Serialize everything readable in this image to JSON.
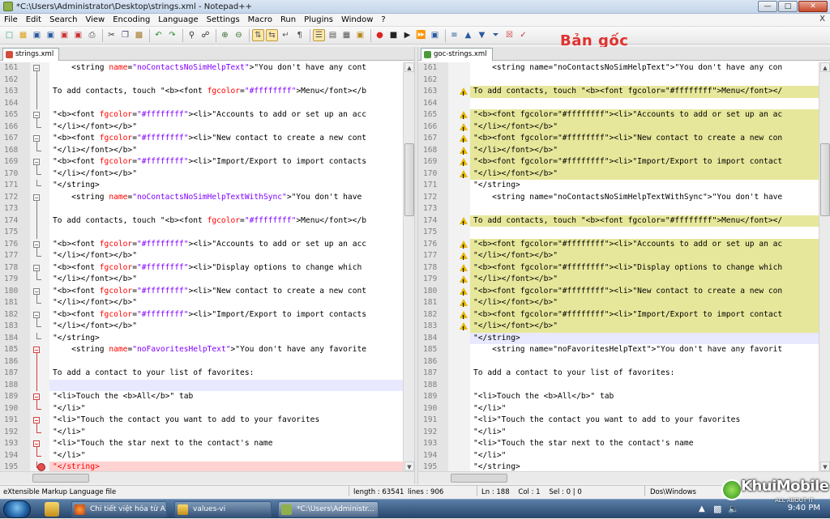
{
  "window": {
    "title": "*C:\\Users\\Administrator\\Desktop\\strings.xml - Notepad++"
  },
  "menu": [
    "File",
    "Edit",
    "Search",
    "View",
    "Encoding",
    "Language",
    "Settings",
    "Macro",
    "Run",
    "Plugins",
    "Window",
    "?"
  ],
  "menu_close": "X",
  "overlay_label": "Bản gốc",
  "left_tab": "strings.xml",
  "right_tab": "goc-strings.xml",
  "left_lines": [
    {
      "n": "161",
      "fold": "box",
      "segs": [
        [
          "t",
          "    <"
        ],
        [
          "t",
          "string "
        ],
        [
          "a",
          "name"
        ],
        [
          "t",
          "="
        ],
        [
          "s",
          "\"noContactsNoSimHelpText\""
        ],
        [
          "t",
          ">\"You don't have any cont"
        ]
      ]
    },
    {
      "n": "162",
      "fold": "line",
      "segs": []
    },
    {
      "n": "163",
      "fold": "line",
      "segs": [
        [
          "t",
          "To add contacts, touch \"<b><font "
        ],
        [
          "a",
          "fgcolor"
        ],
        [
          "t",
          "="
        ],
        [
          "s",
          "\"#ffffffff\""
        ],
        [
          "t",
          ">Menu</font></b"
        ]
      ]
    },
    {
      "n": "164",
      "fold": "line",
      "segs": []
    },
    {
      "n": "165",
      "fold": "box",
      "segs": [
        [
          "t",
          "\"<b><font "
        ],
        [
          "a",
          "fgcolor"
        ],
        [
          "t",
          "="
        ],
        [
          "s",
          "\"#ffffffff\""
        ],
        [
          "t",
          "><li>\"Accounts to add or set up an acc"
        ]
      ]
    },
    {
      "n": "166",
      "fold": "end",
      "segs": [
        [
          "t",
          "\"</li></font></b>\""
        ]
      ]
    },
    {
      "n": "167",
      "fold": "box",
      "segs": [
        [
          "t",
          "\"<b><font "
        ],
        [
          "a",
          "fgcolor"
        ],
        [
          "t",
          "="
        ],
        [
          "s",
          "\"#ffffffff\""
        ],
        [
          "t",
          "><li>\"New contact to create a new cont"
        ]
      ]
    },
    {
      "n": "168",
      "fold": "end",
      "segs": [
        [
          "t",
          "\"</li></font></b>\""
        ]
      ]
    },
    {
      "n": "169",
      "fold": "box",
      "segs": [
        [
          "t",
          "\"<b><font "
        ],
        [
          "a",
          "fgcolor"
        ],
        [
          "t",
          "="
        ],
        [
          "s",
          "\"#ffffffff\""
        ],
        [
          "t",
          "><li>\"Import/Export to import contacts"
        ]
      ]
    },
    {
      "n": "170",
      "fold": "end",
      "segs": [
        [
          "t",
          "\"</li></font></b>\""
        ]
      ]
    },
    {
      "n": "171",
      "fold": "end",
      "segs": [
        [
          "t",
          "\"</string>"
        ]
      ]
    },
    {
      "n": "172",
      "fold": "box",
      "segs": [
        [
          "t",
          "    <"
        ],
        [
          "t",
          "string "
        ],
        [
          "a",
          "name"
        ],
        [
          "t",
          "="
        ],
        [
          "s",
          "\"noContactsNoSimHelpTextWithSync\""
        ],
        [
          "t",
          ">\"You don't have "
        ]
      ]
    },
    {
      "n": "173",
      "fold": "line",
      "segs": []
    },
    {
      "n": "174",
      "fold": "line",
      "segs": [
        [
          "t",
          "To add contacts, touch \"<b><font "
        ],
        [
          "a",
          "fgcolor"
        ],
        [
          "t",
          "="
        ],
        [
          "s",
          "\"#ffffffff\""
        ],
        [
          "t",
          ">Menu</font></b"
        ]
      ]
    },
    {
      "n": "175",
      "fold": "line",
      "segs": []
    },
    {
      "n": "176",
      "fold": "box",
      "segs": [
        [
          "t",
          "\"<b><font "
        ],
        [
          "a",
          "fgcolor"
        ],
        [
          "t",
          "="
        ],
        [
          "s",
          "\"#ffffffff\""
        ],
        [
          "t",
          "><li>\"Accounts to add or set up an acc"
        ]
      ]
    },
    {
      "n": "177",
      "fold": "end",
      "segs": [
        [
          "t",
          "\"</li></font></b>\""
        ]
      ]
    },
    {
      "n": "178",
      "fold": "box",
      "segs": [
        [
          "t",
          "\"<b><font "
        ],
        [
          "a",
          "fgcolor"
        ],
        [
          "t",
          "="
        ],
        [
          "s",
          "\"#ffffffff\""
        ],
        [
          "t",
          "><li>\"Display options to change which "
        ]
      ]
    },
    {
      "n": "179",
      "fold": "end",
      "segs": [
        [
          "t",
          "\"</li></font></b>\""
        ]
      ]
    },
    {
      "n": "180",
      "fold": "box",
      "segs": [
        [
          "t",
          "\"<b><font "
        ],
        [
          "a",
          "fgcolor"
        ],
        [
          "t",
          "="
        ],
        [
          "s",
          "\"#ffffffff\""
        ],
        [
          "t",
          "><li>\"New contact to create a new cont"
        ]
      ]
    },
    {
      "n": "181",
      "fold": "end",
      "segs": [
        [
          "t",
          "\"</li></font></b>\""
        ]
      ]
    },
    {
      "n": "182",
      "fold": "box",
      "segs": [
        [
          "t",
          "\"<b><font "
        ],
        [
          "a",
          "fgcolor"
        ],
        [
          "t",
          "="
        ],
        [
          "s",
          "\"#ffffffff\""
        ],
        [
          "t",
          "><li>\"Import/Export to import contacts"
        ]
      ]
    },
    {
      "n": "183",
      "fold": "end",
      "segs": [
        [
          "t",
          "\"</li></font></b>\""
        ]
      ]
    },
    {
      "n": "184",
      "fold": "end",
      "segs": [
        [
          "t",
          "\"</string>"
        ]
      ]
    },
    {
      "n": "185",
      "fold": "boxred",
      "segs": [
        [
          "t",
          "    <"
        ],
        [
          "t",
          "string "
        ],
        [
          "a",
          "name"
        ],
        [
          "t",
          "="
        ],
        [
          "s",
          "\"noFavoritesHelpText\""
        ],
        [
          "t",
          ">\"You don't have any favorite"
        ]
      ]
    },
    {
      "n": "186",
      "fold": "linered",
      "segs": []
    },
    {
      "n": "187",
      "fold": "linered",
      "segs": [
        [
          "t",
          "To add a contact to your list of favorites:"
        ]
      ]
    },
    {
      "n": "188",
      "fold": "linered",
      "cls": "cur",
      "segs": []
    },
    {
      "n": "189",
      "fold": "boxred",
      "segs": [
        [
          "t",
          "\"<li>Touch the <b>All</b>\" tab"
        ]
      ]
    },
    {
      "n": "190",
      "fold": "endred",
      "segs": [
        [
          "t",
          "\"</li>\""
        ]
      ]
    },
    {
      "n": "191",
      "fold": "boxred",
      "segs": [
        [
          "t",
          "\"<li>\"Touch the contact you want to add to your favorites"
        ]
      ]
    },
    {
      "n": "192",
      "fold": "endred",
      "segs": [
        [
          "t",
          "\"</li>\""
        ]
      ]
    },
    {
      "n": "193",
      "fold": "boxred",
      "segs": [
        [
          "t",
          "\"<li>\"Touch the star next to the contact's name"
        ]
      ]
    },
    {
      "n": "194",
      "fold": "endred",
      "segs": [
        [
          "t",
          "\"</li>\""
        ]
      ]
    },
    {
      "n": "195",
      "fold": "errend",
      "cls": "err",
      "segs": [
        [
          "a",
          "\"</string>"
        ]
      ]
    }
  ],
  "right_lines": [
    {
      "n": "161",
      "w": 0,
      "t": "    <string name=\"noContactsNoSimHelpText\">\"You don't have any con"
    },
    {
      "n": "162",
      "w": 0,
      "t": ""
    },
    {
      "n": "163",
      "w": 1,
      "t": "To add contacts, touch \"<b><font fgcolor=\"#ffffffff\">Menu</font></"
    },
    {
      "n": "164",
      "w": 0,
      "t": ""
    },
    {
      "n": "165",
      "w": 1,
      "t": "\"<b><font fgcolor=\"#ffffffff\"><li>\"Accounts to add or set up an ac"
    },
    {
      "n": "166",
      "w": 1,
      "t": "\"</li></font></b>\""
    },
    {
      "n": "167",
      "w": 1,
      "t": "\"<b><font fgcolor=\"#ffffffff\"><li>\"New contact to create a new con"
    },
    {
      "n": "168",
      "w": 1,
      "t": "\"</li></font></b>\""
    },
    {
      "n": "169",
      "w": 1,
      "t": "\"<b><font fgcolor=\"#ffffffff\"><li>\"Import/Export to import contact"
    },
    {
      "n": "170",
      "w": 1,
      "t": "\"</li></font></b>\""
    },
    {
      "n": "171",
      "w": 0,
      "t": "\"</string>"
    },
    {
      "n": "172",
      "w": 0,
      "t": "    <string name=\"noContactsNoSimHelpTextWithSync\">\"You don't have"
    },
    {
      "n": "173",
      "w": 0,
      "t": ""
    },
    {
      "n": "174",
      "w": 1,
      "t": "To add contacts, touch \"<b><font fgcolor=\"#ffffffff\">Menu</font></"
    },
    {
      "n": "175",
      "w": 0,
      "t": ""
    },
    {
      "n": "176",
      "w": 1,
      "t": "\"<b><font fgcolor=\"#ffffffff\"><li>\"Accounts to add or set up an ac"
    },
    {
      "n": "177",
      "w": 1,
      "t": "\"</li></font></b>\""
    },
    {
      "n": "178",
      "w": 1,
      "t": "\"<b><font fgcolor=\"#ffffffff\"><li>\"Display options to change which"
    },
    {
      "n": "179",
      "w": 1,
      "t": "\"</li></font></b>\""
    },
    {
      "n": "180",
      "w": 1,
      "t": "\"<b><font fgcolor=\"#ffffffff\"><li>\"New contact to create a new con"
    },
    {
      "n": "181",
      "w": 1,
      "t": "\"</li></font></b>\""
    },
    {
      "n": "182",
      "w": 1,
      "t": "\"<b><font fgcolor=\"#ffffffff\"><li>\"Import/Export to import contact"
    },
    {
      "n": "183",
      "w": 1,
      "t": "\"</li></font></b>\""
    },
    {
      "n": "184",
      "w": 0,
      "cur": 1,
      "t": "\"</string>"
    },
    {
      "n": "185",
      "w": 0,
      "t": "    <string name=\"noFavoritesHelpText\">\"You don't have any favorit"
    },
    {
      "n": "186",
      "w": 0,
      "t": ""
    },
    {
      "n": "187",
      "w": 0,
      "t": "To add a contact to your list of favorites:"
    },
    {
      "n": "188",
      "w": 0,
      "t": ""
    },
    {
      "n": "189",
      "w": 0,
      "t": "\"<li>Touch the <b>All</b>\" tab"
    },
    {
      "n": "190",
      "w": 0,
      "t": "\"</li>\""
    },
    {
      "n": "191",
      "w": 0,
      "t": "\"<li>\"Touch the contact you want to add to your favorites"
    },
    {
      "n": "192",
      "w": 0,
      "t": "\"</li>\""
    },
    {
      "n": "193",
      "w": 0,
      "t": "\"<li>\"Touch the star next to the contact's name"
    },
    {
      "n": "194",
      "w": 0,
      "t": "\"</li>\""
    },
    {
      "n": "195",
      "w": 0,
      "t": "\"</string>"
    }
  ],
  "status": {
    "filetype": "eXtensible Markup Language file",
    "length": "length : 63541",
    "lines": "lines : 906",
    "pos": "Ln : 188    Col : 1    Sel : 0 | 0",
    "eol": "Dos\\Windows"
  },
  "taskbar": {
    "items": [
      "Chi tiết việt hóa từ A...",
      "values-vi",
      "*C:\\Users\\Administr..."
    ],
    "clock": "9:40 PM"
  },
  "watermark": {
    "brand": "KhuiMobile",
    "tag": "ALL ABOUT IT"
  },
  "colors": {
    "tag_text": "#000000",
    "attr_name": "#ff0000",
    "attr_value": "#8000ff",
    "diff_bg": "#e7e79b",
    "current_line": "#e8e8ff",
    "error_line": "#ffd2d2",
    "overlay": "#e0322e"
  }
}
